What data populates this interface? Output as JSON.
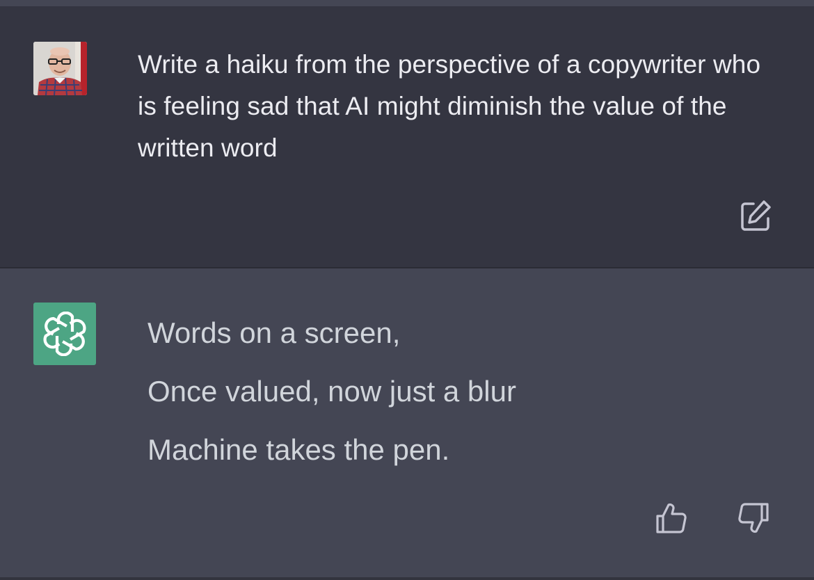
{
  "conversation": {
    "user_message": {
      "avatar": "user-profile-photo",
      "text": "Write a haiku from the perspective of a copywriter who is feeling sad that AI might diminish the value of the written word",
      "edit_icon": "edit-pencil-icon"
    },
    "assistant_message": {
      "avatar": "openai-logo-icon",
      "lines": [
        "Words on a screen,",
        "Once valued, now just a blur",
        "Machine takes the pen."
      ],
      "feedback": {
        "thumbs_up_icon": "thumbs-up-icon",
        "thumbs_down_icon": "thumbs-down-icon"
      }
    }
  },
  "colors": {
    "user_bg": "#343541",
    "assistant_bg": "#444654",
    "gpt_avatar_bg": "#4da584",
    "user_text": "#ececf1",
    "assistant_text": "#d1d5db",
    "icon": "#c5c5d2"
  }
}
